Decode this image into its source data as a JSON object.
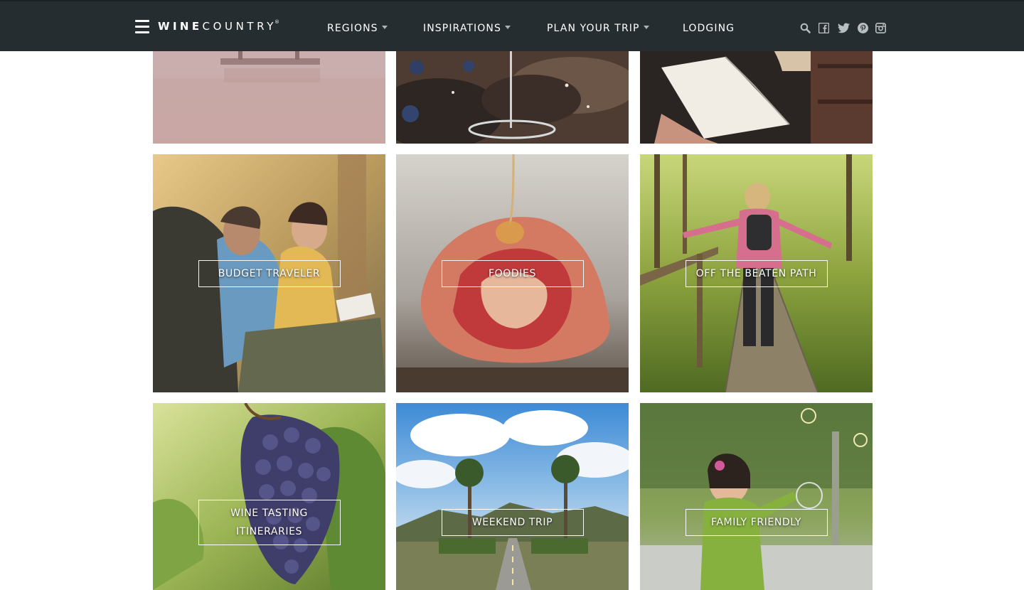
{
  "header": {
    "logo_bold": "WINE",
    "logo_thin": "COUNTRY",
    "logo_reg": "®",
    "nav": [
      {
        "label": "REGIONS",
        "dropdown": true
      },
      {
        "label": "INSPIRATIONS",
        "dropdown": true
      },
      {
        "label": "PLAN YOUR TRIP",
        "dropdown": true
      },
      {
        "label": "LODGING",
        "dropdown": false
      }
    ],
    "social_icons": [
      "search-icon",
      "facebook-icon",
      "twitter-icon",
      "pinterest-icon",
      "instagram-icon"
    ],
    "colors": {
      "bar": "#262d30",
      "text": "#ffffff",
      "icons": "#b9bec0"
    }
  },
  "tiles": [
    {
      "label": "",
      "image": "boat-on-misty-lake"
    },
    {
      "label": "",
      "image": "wine-glass-with-blueberries"
    },
    {
      "label": "",
      "image": "woman-reading-book"
    },
    {
      "label": "BUDGET TRAVELER",
      "image": "backpackers-reading-map"
    },
    {
      "label": "FOODIES",
      "image": "fig-with-honey"
    },
    {
      "label": "OFF THE BEATEN PATH",
      "image": "hiker-on-boardwalk"
    },
    {
      "label": "WINE TASTING ITINERARIES",
      "image": "grape-cluster"
    },
    {
      "label": "WEEKEND TRIP",
      "image": "palm-lined-road"
    },
    {
      "label": "FAMILY FRIENDLY",
      "image": "child-with-bubbles"
    }
  ]
}
